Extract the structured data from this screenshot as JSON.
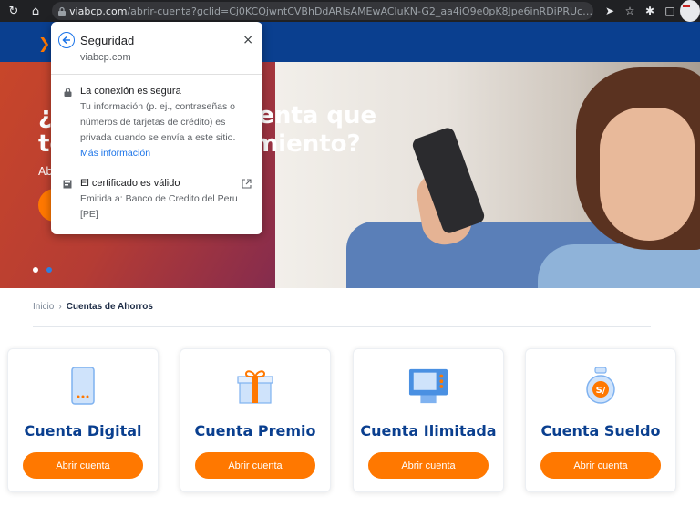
{
  "browser": {
    "url_domain": "viabcp.com",
    "url_path": "/abrir-cuenta?gclid=Cj0KCQjwntCVBhDdARIsAMEwACluKN-G2_aa4iO9e0pK8Jpe6inRDiPRUcqQLcdGfGQ_sBGh...",
    "icons": [
      "reload-icon",
      "home-icon",
      "lock-icon",
      "send-icon",
      "star-icon",
      "extensions-icon",
      "sidebar-icon",
      "blocked-icon"
    ]
  },
  "hero": {
    "headline_line1": "¿A",
    "headline_line1_end": "enta que",
    "headline_line2": "te",
    "headline_line2_end": "miento?",
    "sub": "Ab",
    "slides": 2,
    "active_slide": 2
  },
  "breadcrumb": {
    "home": "Inicio",
    "separator": "›",
    "current": "Cuentas de Ahorros"
  },
  "cards": [
    {
      "title": "Cuenta Digital",
      "button": "Abrir cuenta",
      "icon": "phone-icon"
    },
    {
      "title": "Cuenta Premio",
      "button": "Abrir cuenta",
      "icon": "gift-icon"
    },
    {
      "title": "Cuenta Ilimitada",
      "button": "Abrir cuenta",
      "icon": "atm-icon"
    },
    {
      "title": "Cuenta Sueldo",
      "button": "Abrir cuenta",
      "icon": "money-bag-icon"
    }
  ],
  "popup": {
    "title": "Seguridad",
    "domain": "viabcp.com",
    "close": "×",
    "connection_title": "La conexión es segura",
    "connection_desc": "Tu información (p. ej., contraseñas o números de tarjetas de crédito) es privada cuando se envía a este sitio.",
    "more_info": "Más información",
    "certificate_title": "El certificado es válido",
    "certificate_desc": "Emitida a: Banco de Credito del Peru [PE]"
  },
  "colors": {
    "brand_blue": "#0a3f8f",
    "brand_orange": "#ff7800",
    "link_blue": "#1a73e8"
  }
}
